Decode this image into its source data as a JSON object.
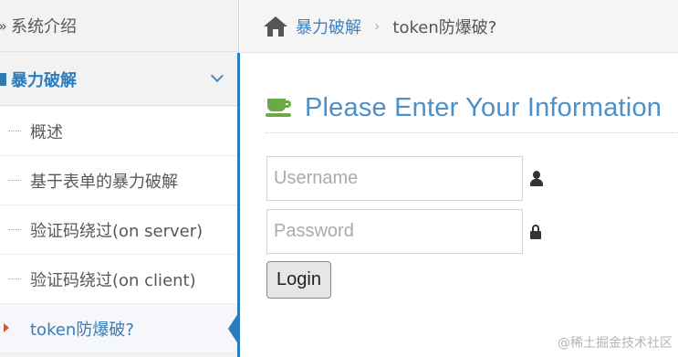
{
  "sidebar": {
    "top_item": "系统介绍",
    "group_label": "暴力破解",
    "items": [
      {
        "label": "概述"
      },
      {
        "label": "基于表单的暴力破解"
      },
      {
        "label": "验证码绕过(on server)"
      },
      {
        "label": "验证码绕过(on client)"
      },
      {
        "label": "token防爆破?"
      }
    ],
    "active_index": 4
  },
  "breadcrumb": {
    "home_icon": "home-icon",
    "parent": "暴力破解",
    "separator": "›",
    "current": "token防爆破?"
  },
  "form": {
    "title": "Please Enter Your Information",
    "title_icon": "coffee-cup-icon",
    "username_placeholder": "Username",
    "username_value": "",
    "password_placeholder": "Password",
    "password_value": "",
    "login_label": "Login"
  },
  "watermark": "@稀土掘金技术社区",
  "colors": {
    "accent_blue": "#2b7dbc",
    "title_blue": "#4e8fc6",
    "icon_green": "#69aa46",
    "active_caret": "#c86139"
  }
}
